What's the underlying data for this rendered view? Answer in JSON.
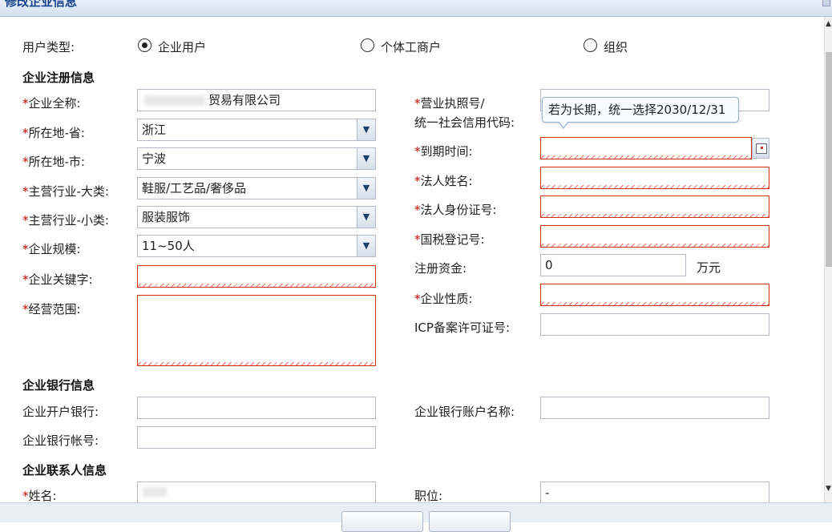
{
  "window": {
    "title": "修改企业信息"
  },
  "user_type": {
    "label": "用户类型:",
    "options": [
      {
        "label": "企业用户",
        "selected": true
      },
      {
        "label": "个体工商户",
        "selected": false
      },
      {
        "label": "组织",
        "selected": false
      }
    ]
  },
  "sections": {
    "registration": "企业注册信息",
    "bank": "企业银行信息",
    "contact": "企业联系人信息"
  },
  "left_fields": {
    "full_name": {
      "label": "企业全称:",
      "value": "贸易有限公司"
    },
    "province": {
      "label": "所在地-省:",
      "value": "浙江"
    },
    "city": {
      "label": "所在地-市:",
      "value": "宁波"
    },
    "industry_major": {
      "label": "主营行业-大类:",
      "value": "鞋服/工艺品/奢侈品"
    },
    "industry_minor": {
      "label": "主营行业-小类:",
      "value": "服装服饰"
    },
    "scale": {
      "label": "企业规模:",
      "value": "11~50人"
    },
    "keywords": {
      "label": "企业关键字:",
      "value": ""
    },
    "business_scope": {
      "label": "经营范围:",
      "value": ""
    }
  },
  "right_fields": {
    "license_no": {
      "label_line1": "营业执照号/",
      "label_line2": "统一社会信用代码:",
      "value": ""
    },
    "expiry": {
      "label": "到期时间:",
      "value": ""
    },
    "legal_name": {
      "label": "法人姓名:",
      "value": ""
    },
    "legal_id": {
      "label": "法人身份证号:",
      "value": ""
    },
    "tax_no": {
      "label": "国税登记号:",
      "value": ""
    },
    "capital": {
      "label": "注册资金:",
      "value": "0",
      "unit": "万元"
    },
    "nature": {
      "label": "企业性质:",
      "value": ""
    },
    "icp": {
      "label": "ICP备案许可证号:",
      "value": ""
    }
  },
  "tooltip": {
    "text": "若为长期，统一选择2030/12/31"
  },
  "bank_fields": {
    "bank_name": {
      "label": "企业开户银行:",
      "value": ""
    },
    "account_name": {
      "label": "企业银行账户名称:",
      "value": ""
    },
    "account_no": {
      "label": "企业银行帐号:",
      "value": ""
    }
  },
  "contact_fields": {
    "name": {
      "label": "姓名:",
      "value": ""
    },
    "position": {
      "label": "职位:",
      "value": "-"
    }
  },
  "required_marker": "*"
}
